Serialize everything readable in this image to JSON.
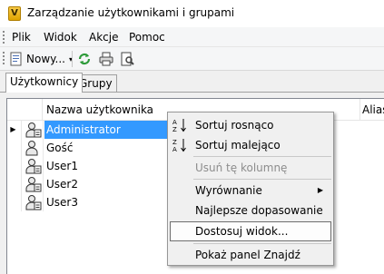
{
  "window": {
    "title": "Zarządzanie użytkownikami i grupami",
    "app_icon_letter": "V"
  },
  "menubar": {
    "items": [
      "Plik",
      "Widok",
      "Akcje",
      "Pomoc"
    ]
  },
  "toolbar": {
    "new_label": "Nowy...",
    "refresh": "refresh-icon",
    "print": "printer-icon",
    "preview": "print-preview-icon"
  },
  "tabs": [
    {
      "label": "Użytkownicy",
      "active": true
    },
    {
      "label": "Grupy",
      "active": false
    }
  ],
  "grid": {
    "columns": [
      "Nazwa użytkownika",
      "Alias"
    ],
    "rows": [
      {
        "name": "Administrator",
        "selected": true
      },
      {
        "name": "Gość",
        "selected": false
      },
      {
        "name": "User1",
        "selected": false
      },
      {
        "name": "User2",
        "selected": false
      },
      {
        "name": "User3",
        "selected": false
      }
    ]
  },
  "context_menu": {
    "items": [
      {
        "label": "Sortuj rosnąco",
        "icon": "sort-ascending-icon"
      },
      {
        "label": "Sortuj malejąco",
        "icon": "sort-descending-icon"
      },
      {
        "label": "Usuń tę kolumnę",
        "disabled": true
      },
      {
        "label": "Wyrównanie",
        "submenu": true
      },
      {
        "label": "Najlepsze dopasowanie"
      },
      {
        "label": "Dostosuj widok...",
        "hover": true
      },
      {
        "label": "Pokaż panel Znajdź"
      }
    ]
  },
  "colors": {
    "selection": "#3399ff",
    "menu_bg": "#f0f0f0"
  }
}
